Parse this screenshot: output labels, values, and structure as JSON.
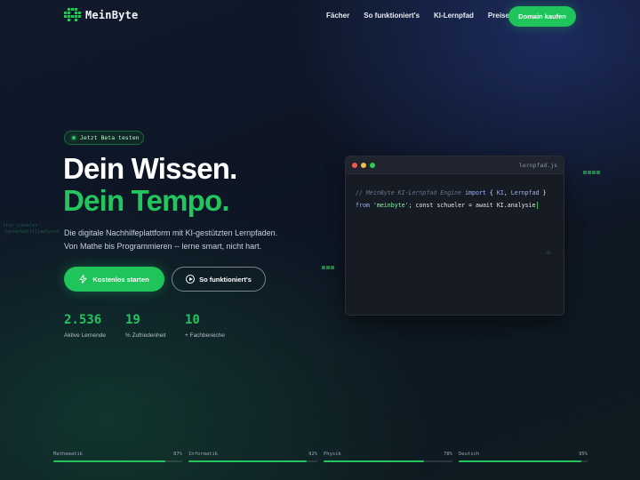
{
  "brand": {
    "name": "MeinByte",
    "accent": "#22c55e"
  },
  "nav": {
    "links": [
      "Fächer",
      "So funktioniert's",
      "KI-Lernpfad",
      "Preise"
    ],
    "cta": "Domain kaufen"
  },
  "hero": {
    "badge": "Jetzt Beta testen",
    "title_line1": "Dein Wissen.",
    "title_line2": "Dein Tempo.",
    "subtitle_line1": "Die digitale Nachhilfeplattform mit KI-gestützten Lernpfaden.",
    "subtitle_line2": "Von Mathe bis Programmieren -- lerne smart, nicht hart.",
    "primary_button": "Kostenlos starten",
    "secondary_button": "So funktioniert's"
  },
  "stats": [
    {
      "value": "2.536",
      "label": "Aktive Lernende"
    },
    {
      "value": "19",
      "label": "% Zufriedenheit"
    },
    {
      "value": "10",
      "label": "+ Fachbereiche"
    }
  ],
  "code_window": {
    "filename": "lernpfad.js",
    "line1_comment": "// MeinByte KI-Lernpfad Engine",
    "line1_kw": "import",
    "line1_rest_a": "{",
    "line1_ki": "KI",
    "line1_comma": ",",
    "line1_lernpfad": "Lernpfad",
    "line1_rest_b": "}",
    "line2_from": "from",
    "line2_str": "'meinbyte'",
    "line2_rest": "; const schueler = await KI.analysie"
  },
  "decor": {
    "ghost_code": ".find_schueler\n  Lernpfad(t)[]aalysie\n,",
    "ghost_small": "ab"
  },
  "progress": [
    {
      "subject": "Mathematik",
      "percent_label": "87%",
      "value": 87
    },
    {
      "subject": "Informatik",
      "percent_label": "92%",
      "value": 92
    },
    {
      "subject": "Physik",
      "percent_label": "78%",
      "value": 78
    },
    {
      "subject": "Deutsch",
      "percent_label": "95%",
      "value": 95
    }
  ],
  "colors": {
    "dot_red": "#ef5b50",
    "dot_yellow": "#f4bf4f",
    "dot_green": "#2bcd52"
  }
}
